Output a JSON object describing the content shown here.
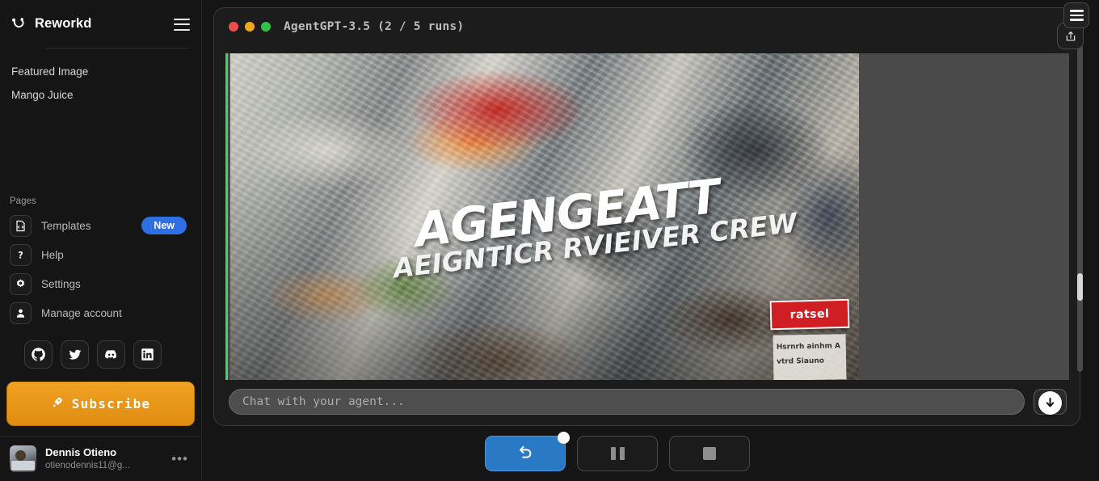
{
  "sidebar": {
    "brand": "Reworkd",
    "logo_icon": "reworkd-logo-icon",
    "menu_icon": "hamburger-menu-icon",
    "pages": [
      {
        "label": "Featured Image"
      },
      {
        "label": "Mango Juice"
      }
    ],
    "pages_label": "Pages",
    "nav": [
      {
        "label": "Templates",
        "icon": "template-file-icon",
        "badge": "New"
      },
      {
        "label": "Help",
        "icon": "question-mark-icon",
        "badge": ""
      },
      {
        "label": "Settings",
        "icon": "gear-icon",
        "badge": ""
      },
      {
        "label": "Manage account",
        "icon": "user-person-icon",
        "badge": ""
      }
    ],
    "socials": [
      {
        "name": "github-icon"
      },
      {
        "name": "twitter-icon"
      },
      {
        "name": "discord-icon"
      },
      {
        "name": "linkedin-icon"
      }
    ],
    "subscribe": {
      "label": "Subscribe",
      "icon": "rocket-icon",
      "color": "#e08c10"
    },
    "profile": {
      "name": "Dennis Otieno",
      "email": "otienodennis11@g...",
      "more_icon": "ellipsis-icon"
    }
  },
  "window": {
    "title_prefix": "AgentGPT",
    "title_model": "-3.5",
    "title_runs": "(2 / 5 runs)",
    "title_full": "AgentGPT-3.5 (2 / 5 runs)",
    "lights": [
      "#ef4d4d",
      "#f0a81e",
      "#2fc14a"
    ],
    "accent_line_color": "#2fdc6a"
  },
  "message": {
    "image_headline": "AGENGEATT",
    "image_subline": "AEIGNTICR RVIEIVER CREW",
    "sign_text": "ratsel",
    "sign_sub_text": "Hsrnrh ainhm Avtrd Siauno",
    "alt": "AI generated collage image of scattered debris, magazines and clothing with overlaid distorted text"
  },
  "chat": {
    "placeholder": "Chat with your agent...",
    "value": "",
    "send_icon": "chat-bubble-icon",
    "scroll_down_icon": "scroll-down-arrow-icon"
  },
  "toolbar": {
    "menu_icon": "hamburger-menu-icon",
    "share_icon": "share-upload-icon"
  },
  "controls": [
    {
      "name": "restart-button",
      "icon": "restart-undo-icon",
      "primary": true,
      "badge": true
    },
    {
      "name": "pause-button",
      "icon": "pause-icon",
      "primary": false,
      "badge": false
    },
    {
      "name": "stop-button",
      "icon": "stop-icon",
      "primary": false,
      "badge": false
    }
  ]
}
